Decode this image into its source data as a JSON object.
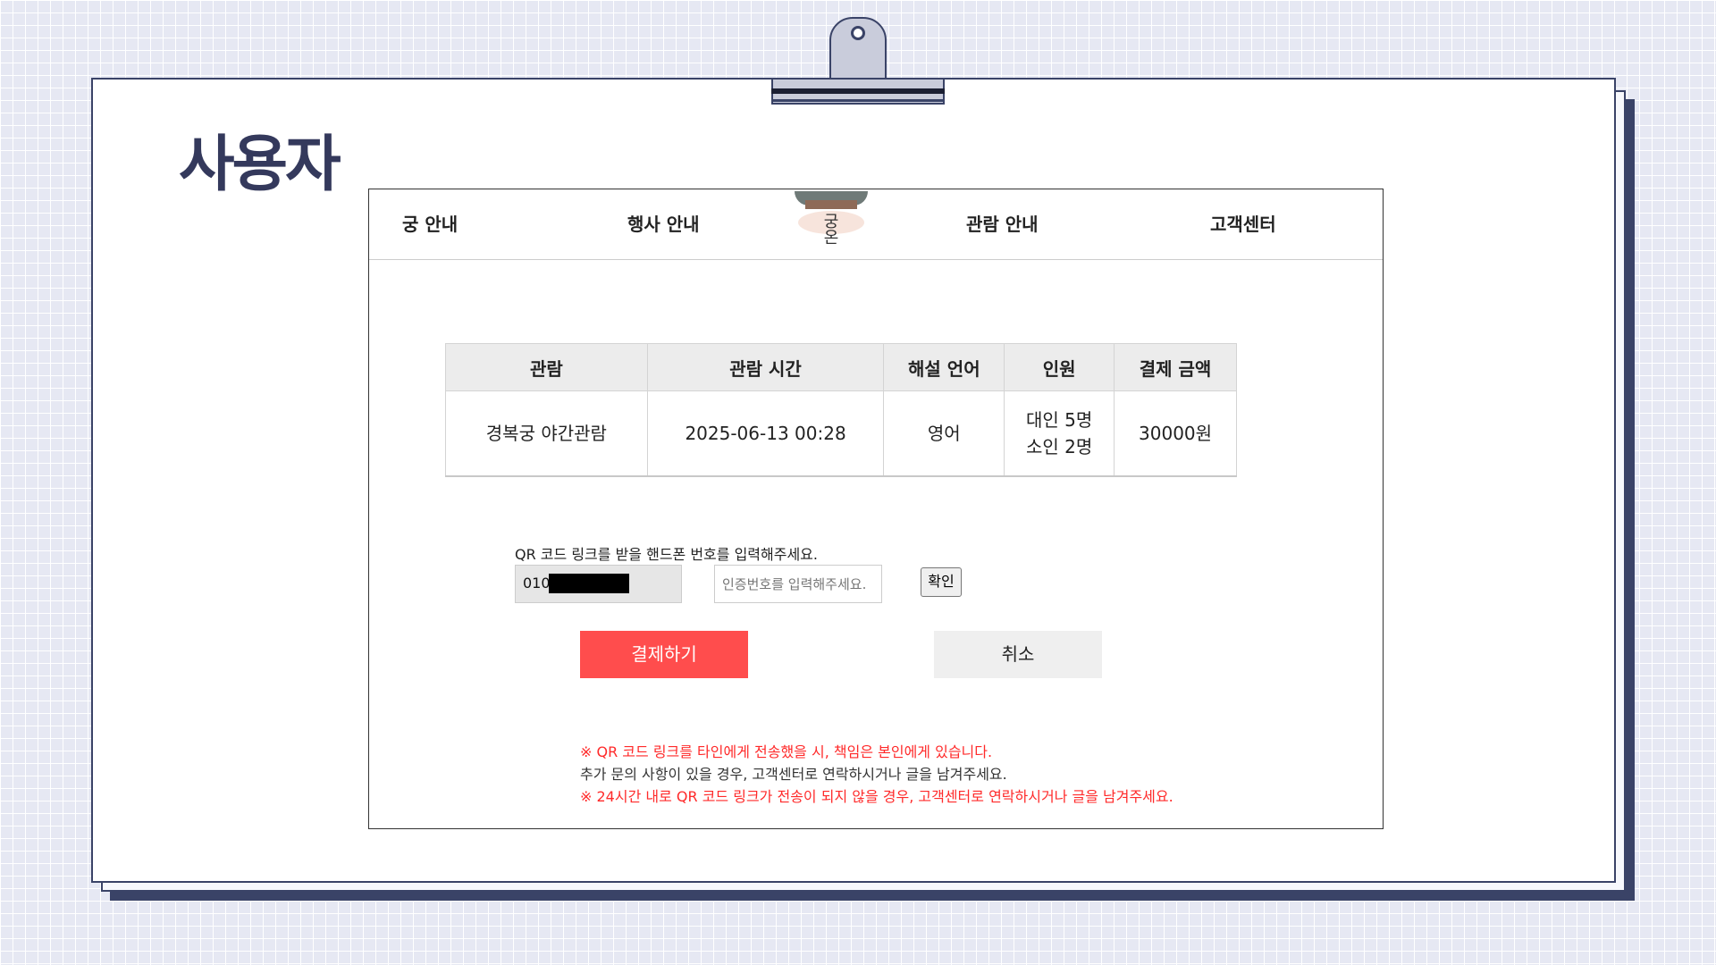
{
  "heading": "사용자",
  "nav": {
    "items": [
      "궁 안내",
      "행사 안내",
      "관람 안내",
      "고객센터"
    ],
    "logo_text": "궁온"
  },
  "table": {
    "headers": [
      "관람",
      "관람 시간",
      "해설 언어",
      "인원",
      "결제 금액"
    ],
    "row": {
      "tour": "경복궁 야간관람",
      "time": "2025-06-13 00:28",
      "language": "영어",
      "people_adult": "대인 5명",
      "people_child": "소인 2명",
      "amount": "30000원"
    }
  },
  "qr": {
    "label": "QR 코드 링크를 받을 핸드폰 번호를 입력해주세요.",
    "phone_prefix": "010",
    "code_placeholder": "인증번호를 입력해주세요.",
    "confirm_label": "확인"
  },
  "buttons": {
    "pay": "결제하기",
    "cancel": "취소"
  },
  "notes": [
    "※ QR 코드 링크를 타인에게 전송했을 시, 책임은 본인에게 있습니다.",
    "추가 문의 사항이 있을 경우, 고객센터로 연락하시거나 글을 남겨주세요.",
    "※ 24시간 내로 QR 코드 링크가 전송이 되지 않을 경우, 고객센터로 연락하시거나 글을 남겨주세요."
  ],
  "colors": {
    "pay_button": "#ff4d4d",
    "notice_red": "#ff2a2a",
    "heading": "#34395c"
  }
}
